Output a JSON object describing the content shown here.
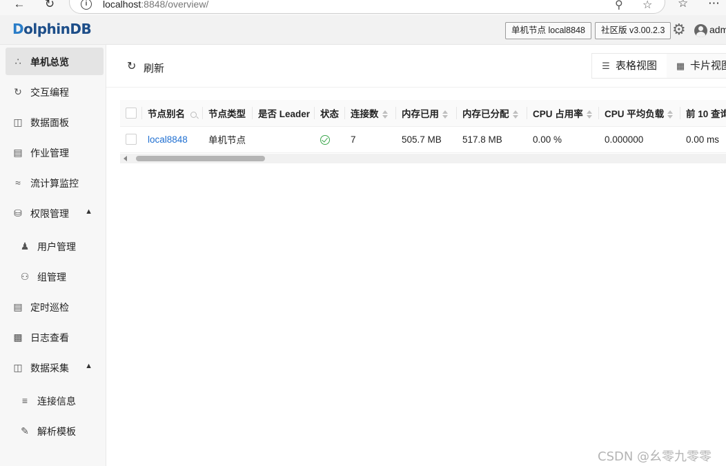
{
  "browser": {
    "url_host": "localhost",
    "url_path": ":8848/overview/"
  },
  "header": {
    "logo": "DolphinDB",
    "logo_first": "D",
    "logo_rest": "olphinDB",
    "node_tag": "单机节点 local8848",
    "version_tag": "社区版 v3.00.2.3",
    "user": "admin"
  },
  "sidebar": {
    "items": [
      {
        "label": "单机总览",
        "icon": "cluster-icon"
      },
      {
        "label": "交互编程",
        "icon": "code-icon"
      },
      {
        "label": "数据面板",
        "icon": "dashboard-icon"
      },
      {
        "label": "作业管理",
        "icon": "job-icon"
      },
      {
        "label": "流计算监控",
        "icon": "stream-icon"
      },
      {
        "label": "权限管理",
        "icon": "lock-icon"
      },
      {
        "label": "用户管理",
        "icon": "user-icon"
      },
      {
        "label": "组管理",
        "icon": "group-icon"
      },
      {
        "label": "定时巡检",
        "icon": "inspection-icon"
      },
      {
        "label": "日志查看",
        "icon": "log-icon"
      },
      {
        "label": "数据采集",
        "icon": "collect-icon"
      },
      {
        "label": "连接信息",
        "icon": "connection-icon"
      },
      {
        "label": "解析模板",
        "icon": "template-icon"
      }
    ]
  },
  "toolbar": {
    "refresh_label": "刷新",
    "table_view": "表格视图",
    "card_view": "卡片视图"
  },
  "table": {
    "columns": [
      "节点别名",
      "节点类型",
      "是否 Leader",
      "状态",
      "连接数",
      "内存已用",
      "内存已分配",
      "CPU 占用率",
      "CPU 平均负载",
      "前 10 查询"
    ],
    "rows": [
      {
        "alias": "local8848",
        "type": "单机节点",
        "leader": "",
        "status": "ok",
        "connections": "7",
        "mem_used": "505.7 MB",
        "mem_alloc": "517.8 MB",
        "cpu_usage": "0.00 %",
        "cpu_load": "0.000000",
        "top10": "0.00 ms"
      }
    ]
  },
  "watermark": "CSDN @幺零九零零",
  "colors": {
    "link": "#1f6fd1",
    "status_ok": "#3aa64b",
    "logo": "#1d4e89"
  }
}
